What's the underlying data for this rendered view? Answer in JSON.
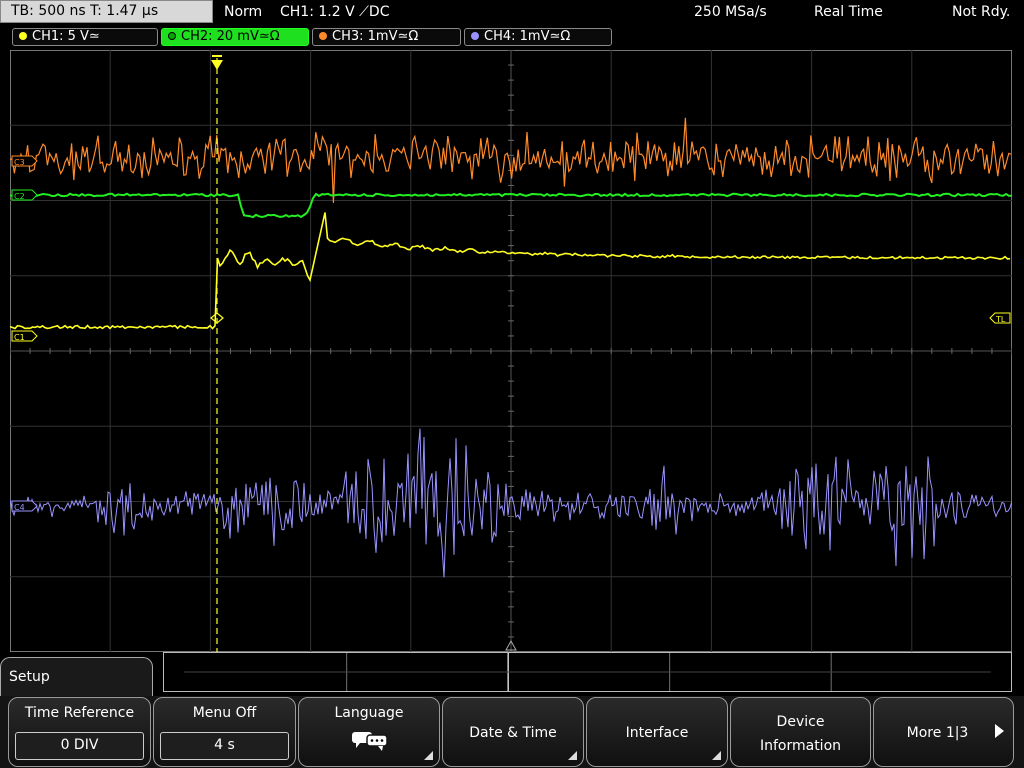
{
  "status": {
    "timebase": "TB: 500 ns   T: 1.47 µs",
    "mode": "Norm",
    "trigger": "CH1: 1.2 V ⟋DC",
    "sample_rate": "250 MSa/s",
    "acq_mode": "Real Time",
    "state": "Not Rdy."
  },
  "channels": [
    {
      "label": "CH1: 5 V≃",
      "color": "#ffff22"
    },
    {
      "label": "CH2: 20 mV≃Ω",
      "color": "#22ee22"
    },
    {
      "label": "CH3: 1mV≃Ω",
      "color": "#ff8a2a"
    },
    {
      "label": "CH4: 1mV≃Ω",
      "color": "#9a93ff"
    }
  ],
  "markers": {
    "trigger_level": "TL",
    "ch1": "C1",
    "ch2": "C2",
    "ch3": "C3",
    "ch4": "C4"
  },
  "menu": {
    "title": "Setup",
    "softkeys": {
      "time_reference": {
        "label": "Time Reference",
        "value": "0 DIV"
      },
      "menu_off": {
        "label": "Menu Off",
        "value": "4 s"
      },
      "language": {
        "label": "Language"
      },
      "date_time": {
        "label": "Date & Time"
      },
      "interface": {
        "label": "Interface"
      },
      "device_info": {
        "line1": "Device",
        "line2": "Information"
      },
      "more": {
        "label": "More 1|3"
      }
    }
  }
}
